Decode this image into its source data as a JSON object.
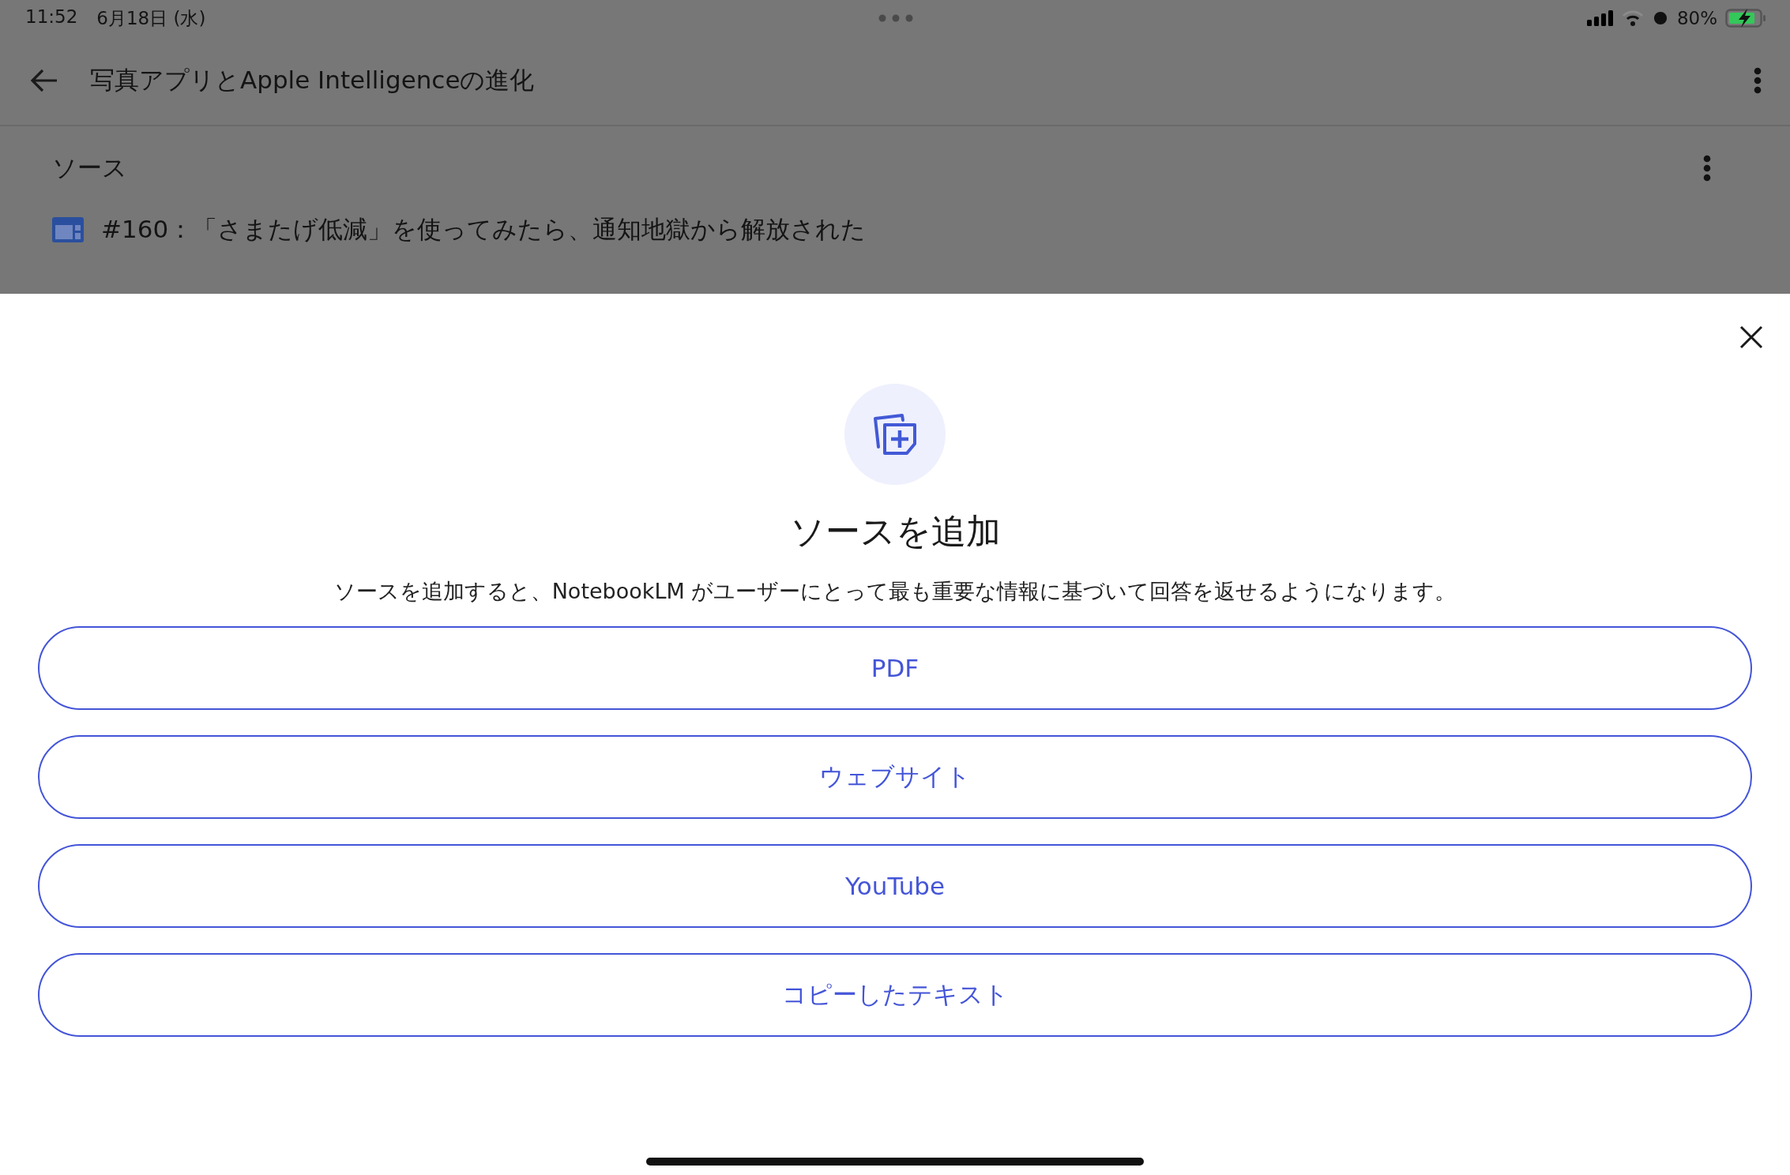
{
  "status_bar": {
    "time": "11:52",
    "date": "6月18日 (水)",
    "battery": "80%"
  },
  "app_bar": {
    "title": "写真アプリとApple Intelligenceの進化"
  },
  "sources_panel": {
    "heading": "ソース",
    "items": [
      {
        "title": "#160：「さまたげ低減」を使ってみたら、通知地獄から解放された"
      }
    ]
  },
  "dialog": {
    "title": "ソースを追加",
    "description": "ソースを追加すると、NotebookLM がユーザーにとって最も重要な情報に基づいて回答を返せるようになります。",
    "options": [
      {
        "label": "PDF"
      },
      {
        "label": "ウェブサイト"
      },
      {
        "label": "YouTube"
      },
      {
        "label": "コピーしたテキスト"
      }
    ]
  }
}
